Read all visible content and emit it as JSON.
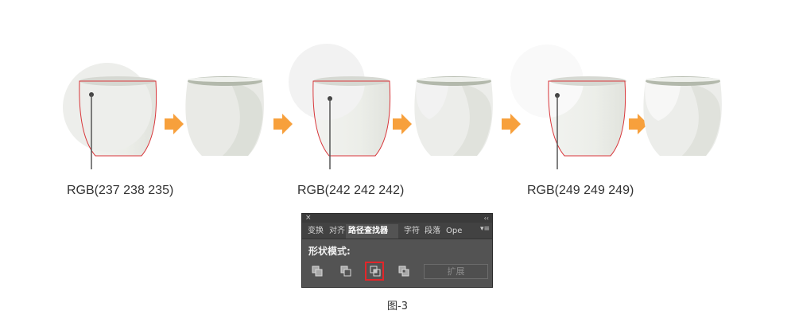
{
  "labels": {
    "rgb_1": "RGB(237 238 235)",
    "rgb_2": "RGB(242 242 242)",
    "rgb_3": "RGB(249 249 249)"
  },
  "colors": {
    "overlay_1": "#edeeeb",
    "overlay_2": "#f2f2f2",
    "overlay_3": "#f9f9f9",
    "arrow": "#f7a03c",
    "outline": "#d8363a",
    "cup_body": "#e9eae6",
    "cup_rim": "#b3b9ac"
  },
  "panel": {
    "close_glyph": "×",
    "collapse_glyph": "‹‹",
    "tabs": [
      {
        "label": "变换"
      },
      {
        "label": "对齐"
      },
      {
        "label": "路径查找器"
      },
      {
        "label": "字符"
      },
      {
        "label": "段落"
      },
      {
        "label": "Ope"
      }
    ],
    "menu_glyph": "▾≡",
    "shape_modes_title": "形状模式:",
    "expand_label": "扩展",
    "mode_icons": [
      "unite-icon",
      "minus-front-icon",
      "intersect-icon",
      "exclude-icon"
    ],
    "selected_mode": "intersect-icon"
  },
  "caption": "图-3"
}
